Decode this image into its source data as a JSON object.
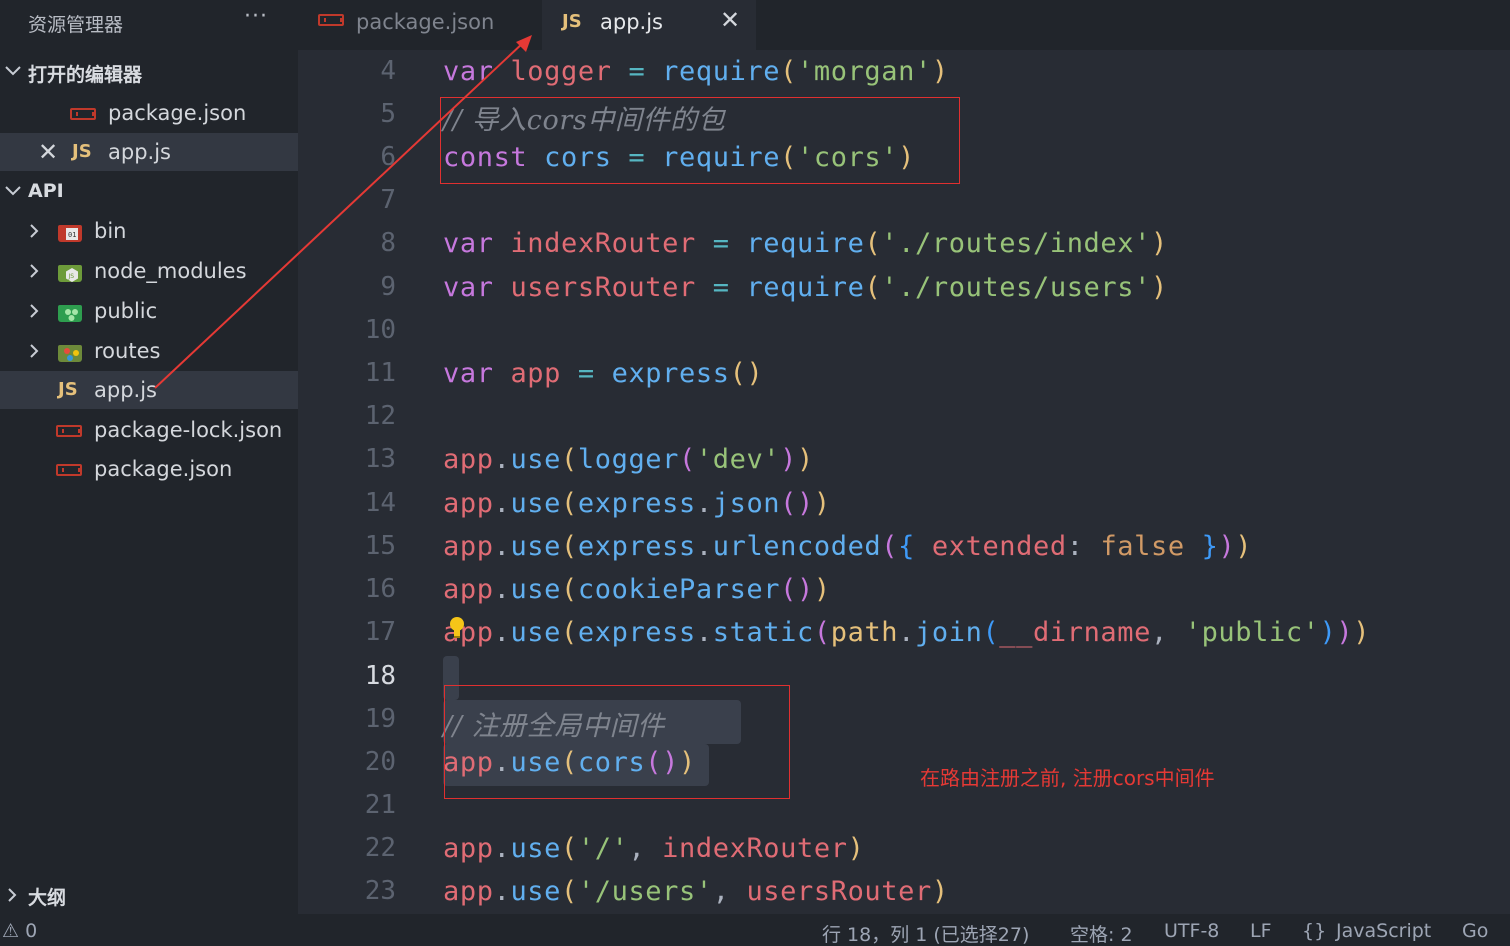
{
  "sidebar": {
    "title": "资源管理器",
    "more": "···",
    "open_editors": {
      "label": "打开的编辑器",
      "items": [
        {
          "label": "package.json",
          "icon": "json-icon"
        },
        {
          "label": "app.js",
          "icon": "js-icon",
          "close": "✕"
        }
      ]
    },
    "project": {
      "label": "API",
      "items": [
        {
          "label": "bin",
          "type": "folder",
          "icon": "bin-folder-icon"
        },
        {
          "label": "node_modules",
          "type": "folder",
          "icon": "node-folder-icon"
        },
        {
          "label": "public",
          "type": "folder",
          "icon": "public-folder-icon"
        },
        {
          "label": "routes",
          "type": "folder",
          "icon": "routes-folder-icon"
        },
        {
          "label": "app.js",
          "type": "file",
          "icon": "js-icon"
        },
        {
          "label": "package-lock.json",
          "type": "file",
          "icon": "json-icon"
        },
        {
          "label": "package.json",
          "type": "file",
          "icon": "json-icon"
        }
      ]
    },
    "outline": {
      "label": "大纲"
    }
  },
  "tabs": [
    {
      "label": "package.json",
      "icon": "json-icon",
      "active": false
    },
    {
      "label": "app.js",
      "icon": "js-icon",
      "active": true,
      "close": "✕"
    }
  ],
  "icons": {
    "js": "JS"
  },
  "editor": {
    "line_numbers": [
      "4",
      "5",
      "6",
      "7",
      "8",
      "9",
      "10",
      "11",
      "12",
      "13",
      "14",
      "15",
      "16",
      "17",
      "18",
      "19",
      "20",
      "21",
      "22",
      "23"
    ],
    "current_line": "18",
    "annotation": "在路由注册之前, 注册cors中间件",
    "lines": {
      "l4": [
        "var",
        "logger",
        "=",
        "require",
        "(",
        "'morgan'",
        ")"
      ],
      "l5": "// 导入cors中间件的包",
      "l6": [
        "const",
        "cors",
        "=",
        "require",
        "(",
        "'cors'",
        ")"
      ],
      "l8": [
        "var",
        "indexRouter",
        "=",
        "require",
        "(",
        "'./routes/index'",
        ")"
      ],
      "l9": [
        "var",
        "usersRouter",
        "=",
        "require",
        "(",
        "'./routes/users'",
        ")"
      ],
      "l11": [
        "var",
        "app",
        "=",
        "express",
        "(",
        ")"
      ],
      "l13": [
        "app",
        ".",
        "use",
        "(",
        "logger",
        "(",
        "'dev'",
        ")",
        ")"
      ],
      "l14": [
        "app",
        ".",
        "use",
        "(",
        "express",
        ".",
        "json",
        "(",
        ")",
        ")"
      ],
      "l15": [
        "app",
        ".",
        "use",
        "(",
        "express",
        ".",
        "urlencoded",
        "(",
        "{",
        "extended",
        ":",
        "false",
        "}",
        ")",
        ")"
      ],
      "l16": [
        "app",
        ".",
        "use",
        "(",
        "cookieParser",
        "(",
        ")",
        ")"
      ],
      "l17": [
        "app",
        ".",
        "use",
        "(",
        "express",
        ".",
        "static",
        "(",
        "path",
        ".",
        "join",
        "(",
        "__dirname",
        ",",
        "'public'",
        ")",
        ")",
        ")"
      ],
      "l19": "// 注册全局中间件",
      "l20": [
        "app",
        ".",
        "use",
        "(",
        "cors",
        "(",
        ")",
        ")"
      ],
      "l22": [
        "app",
        ".",
        "use",
        "(",
        "'/'",
        ",",
        "indexRouter",
        ")"
      ],
      "l23": [
        "app",
        ".",
        "use",
        "(",
        "'/users'",
        ",",
        "usersRouter",
        ")"
      ]
    }
  },
  "statusbar": {
    "problems": "⚠ 0",
    "position": "行 18，列 1 (已选择27)",
    "spaces": "空格: 2",
    "encoding": "UTF-8",
    "eol": "LF",
    "language_icon": "{}",
    "language": "JavaScript",
    "extra": "Go"
  },
  "colors": {
    "keyword": "#c678dd",
    "function": "#61afef",
    "variable": "#e06c75",
    "string": "#98c379",
    "comment": "#7f848e",
    "annotation": "#e53935"
  }
}
